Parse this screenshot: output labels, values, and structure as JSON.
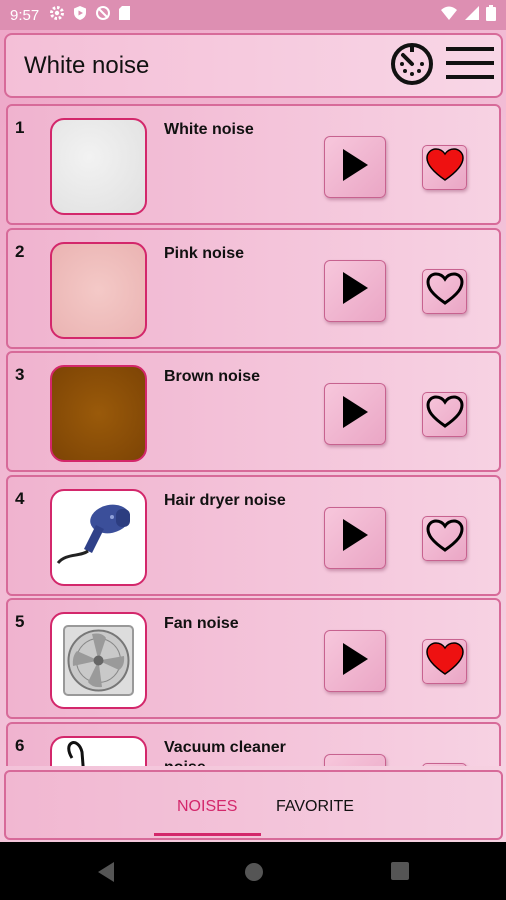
{
  "status_bar": {
    "time": "9:57",
    "left_icons": [
      "gear-icon",
      "play-shield-icon",
      "no-sync-icon",
      "sd-card-icon"
    ],
    "right_icons": [
      "wifi-icon",
      "signal-icon",
      "battery-icon"
    ]
  },
  "header": {
    "title": "White noise",
    "icons": [
      "timer-icon",
      "menu-icon"
    ]
  },
  "noises": [
    {
      "number": "1",
      "title": "White noise",
      "favorite": true,
      "thumb": "white"
    },
    {
      "number": "2",
      "title": "Pink noise",
      "favorite": false,
      "thumb": "pink"
    },
    {
      "number": "3",
      "title": "Brown noise",
      "favorite": false,
      "thumb": "brown"
    },
    {
      "number": "4",
      "title": "Hair dryer noise",
      "favorite": false,
      "thumb": "hairdryer"
    },
    {
      "number": "5",
      "title": "Fan noise",
      "favorite": true,
      "thumb": "fan"
    },
    {
      "number": "6",
      "title": "Vacuum cleaner noise",
      "favorite": false,
      "thumb": "vacuum"
    }
  ],
  "tabs": {
    "noises_label": "NOISES",
    "favorite_label": "FAVORITE",
    "active": "noises"
  },
  "colors": {
    "accent": "#d3276b",
    "heart_filled": "#ee1111",
    "card_border": "#d76a99"
  }
}
